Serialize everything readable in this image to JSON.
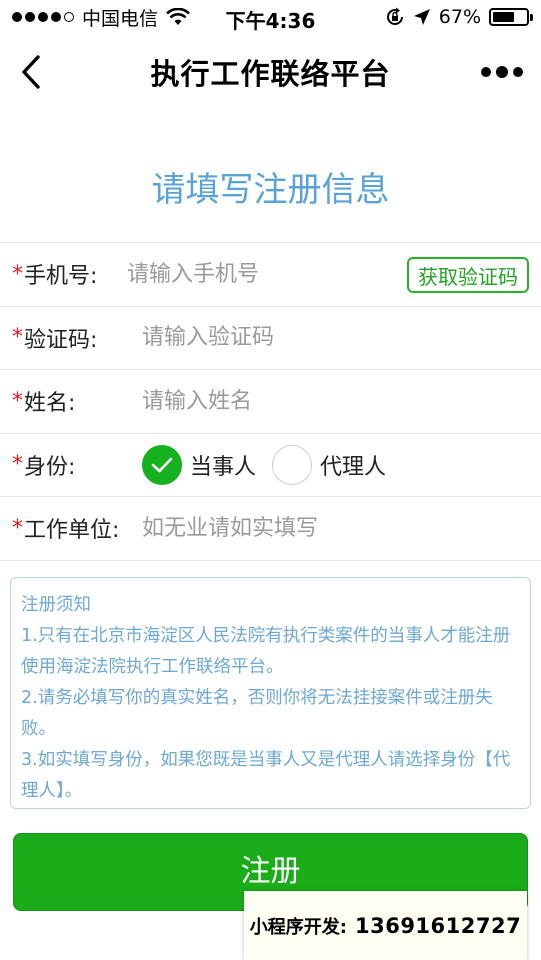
{
  "status_bar": {
    "carrier": "中国电信",
    "time": "下午4:36",
    "battery": "67%",
    "battery_level": 0.67,
    "icons": [
      "signal-dots-icon",
      "wifi-icon",
      "rotation-lock-icon",
      "location-arrow-icon",
      "battery-icon"
    ]
  },
  "nav": {
    "title": "执行工作联络平台",
    "back_icon": "chevron-left-icon",
    "more_icon": "more-dots-icon"
  },
  "form": {
    "heading": "请填写注册信息",
    "required_mark": "*",
    "fields": [
      {
        "label": "手机号:",
        "placeholder": "请输入手机号",
        "value": ""
      },
      {
        "label": "验证码:",
        "placeholder": "请输入验证码",
        "value": ""
      },
      {
        "label": "姓名:",
        "placeholder": "请输入姓名",
        "value": ""
      },
      {
        "label": "身份:"
      },
      {
        "label": "工作单位:",
        "placeholder": "如无业请如实填写",
        "value": ""
      }
    ],
    "sms_button": "获取验证码",
    "identity_options": [
      {
        "label": "当事人",
        "checked": true
      },
      {
        "label": "代理人",
        "checked": false
      }
    ]
  },
  "notice": {
    "title": "注册须知",
    "items": [
      "1.只有在北京市海淀区人民法院有执行类案件的当事人才能注册使用海淀法院执行工作联络平台。",
      "2.请务必填写你的真实姓名，否则你将无法挂接案件或注册失败。",
      "3.如实填写身份，如果您既是当事人又是代理人请选择身份【代理人】。"
    ]
  },
  "register_button": "注册",
  "ad": {
    "label": "小程序开发:",
    "phone": "13691612727"
  },
  "colors": {
    "accent_green": "#1aad19",
    "heading_blue": "#5aa3d8",
    "required_red": "#e01e1e"
  }
}
